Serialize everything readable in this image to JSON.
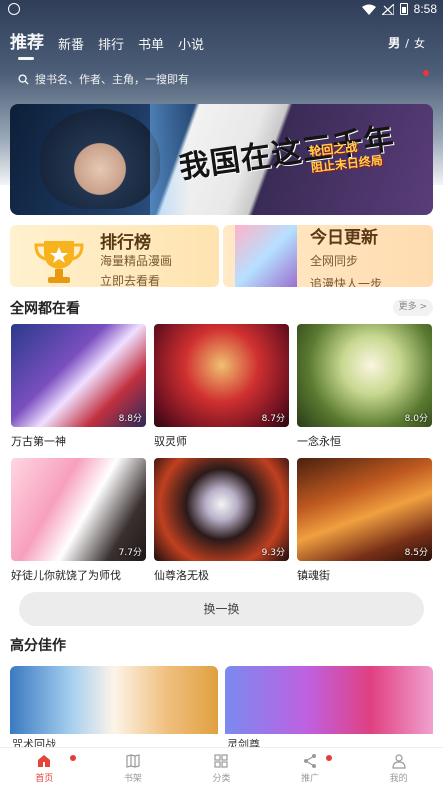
{
  "status_bar": {
    "time": "8:58"
  },
  "tabs": [
    {
      "label": "推荐"
    },
    {
      "label": "新番"
    },
    {
      "label": "排行"
    },
    {
      "label": "书单"
    },
    {
      "label": "小说"
    }
  ],
  "gender": {
    "male": "男",
    "separator": "/",
    "female": "女"
  },
  "search": {
    "placeholder": "搜书名、作者、主角，一搜即有"
  },
  "banner": {
    "title": "我国在这三千年",
    "subtitle_line1": "轮回之战",
    "subtitle_line2": "阻止末日终局"
  },
  "promos": [
    {
      "title": "排行榜",
      "line1": "海量精品漫画",
      "line2": "立即去看看"
    },
    {
      "title": "今日更新",
      "line1": "全网同步",
      "line2": "追漫快人一步"
    }
  ],
  "section_popular": {
    "title": "全网都在看",
    "more": "更多 >",
    "items": [
      {
        "title": "万古第一神",
        "score": "8.8分",
        "color1": "#4a5fb0",
        "color2": "#e0c8f0"
      },
      {
        "title": "驭灵师",
        "score": "8.7分",
        "color1": "#c0202a",
        "color2": "#f0a060"
      },
      {
        "title": "一念永恒",
        "score": "8.0分",
        "color1": "#4d6a2c",
        "color2": "#f4f0d8"
      },
      {
        "title": "好徒儿你就饶了为师伐",
        "score": "7.7分",
        "color1": "#f3a6c0",
        "color2": "#fff0f4"
      },
      {
        "title": "仙尊洛无极",
        "score": "9.3分",
        "color1": "#1a1414",
        "color2": "#d04830"
      },
      {
        "title": "镇魂街",
        "score": "8.5分",
        "color1": "#8a3a20",
        "color2": "#f08a3a"
      }
    ]
  },
  "swap_button": "换一换",
  "section_highscore": {
    "title": "高分佳作",
    "items": [
      {
        "title": "咒术回战"
      },
      {
        "title": "灵剑尊"
      }
    ]
  },
  "bottom_nav": [
    {
      "label": "首页",
      "icon": "home-icon",
      "active": true,
      "dot": true
    },
    {
      "label": "书架",
      "icon": "bookshelf-icon",
      "active": false,
      "dot": false
    },
    {
      "label": "分类",
      "icon": "category-icon",
      "active": false,
      "dot": false
    },
    {
      "label": "推广",
      "icon": "share-icon",
      "active": false,
      "dot": true
    },
    {
      "label": "我的",
      "icon": "profile-icon",
      "active": false,
      "dot": false
    }
  ],
  "colors": {
    "accent": "#e4443a",
    "header_dark": "#2f3d59"
  }
}
